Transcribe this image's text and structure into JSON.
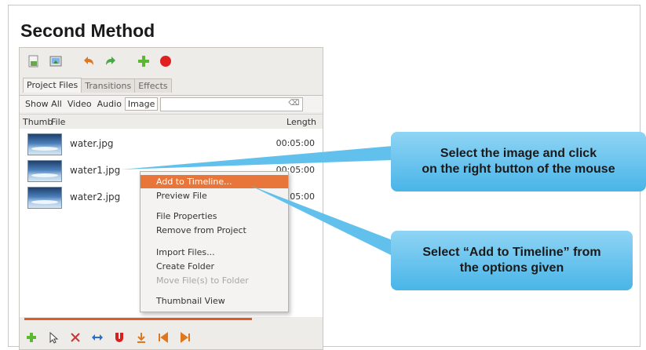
{
  "heading": "Second Method",
  "toolbar": {
    "icons": [
      "new-project-icon",
      "import-files-icon",
      "undo-icon",
      "redo-icon",
      "add-icon",
      "record-icon"
    ]
  },
  "tabs": [
    {
      "label": "Project Files",
      "active": true
    },
    {
      "label": "Transitions",
      "active": false
    },
    {
      "label": "Effects",
      "active": false
    }
  ],
  "filters": [
    {
      "label": "Show All",
      "active": false
    },
    {
      "label": "Video",
      "active": false
    },
    {
      "label": "Audio",
      "active": false
    },
    {
      "label": "Image",
      "active": true
    }
  ],
  "search": {
    "value": "",
    "clear_glyph": "⌫"
  },
  "columns": {
    "thumb": "Thumb",
    "file": "File",
    "length": "Length"
  },
  "files": [
    {
      "name": "water.jpg",
      "length": "00:05:00"
    },
    {
      "name": "water1.jpg",
      "length": "00:05:00"
    },
    {
      "name": "water2.jpg",
      "length": "00:05:00"
    }
  ],
  "context_menu": {
    "items": [
      {
        "label": "Add to Timeline...",
        "highlighted": true,
        "disabled": false
      },
      {
        "label": "Preview File",
        "highlighted": false,
        "disabled": false
      },
      {
        "label": "File Properties",
        "highlighted": false,
        "disabled": false
      },
      {
        "label": "Remove from Project",
        "highlighted": false,
        "disabled": false
      },
      {
        "label": "Import Files...",
        "highlighted": false,
        "disabled": false
      },
      {
        "label": "Create Folder",
        "highlighted": false,
        "disabled": false
      },
      {
        "label": "Move File(s) to Folder",
        "highlighted": false,
        "disabled": true
      },
      {
        "label": "Thumbnail View",
        "highlighted": false,
        "disabled": false
      }
    ]
  },
  "bottom_toolbar": {
    "icons": [
      "add-track-icon",
      "pointer-icon",
      "razor-icon",
      "resize-icon",
      "magnet-icon",
      "marker-icon",
      "previous-marker-icon",
      "next-marker-icon"
    ]
  },
  "callouts": [
    {
      "line1": "Select the image and click",
      "line2": "on the right button of the mouse"
    },
    {
      "line1": "Select “Add to Timeline” from",
      "line2": "the options given"
    }
  ],
  "colors": {
    "accent_orange": "#e8763a",
    "callout_blue": "#49b5e8",
    "record_red": "#e02020",
    "add_green": "#5cb832"
  }
}
